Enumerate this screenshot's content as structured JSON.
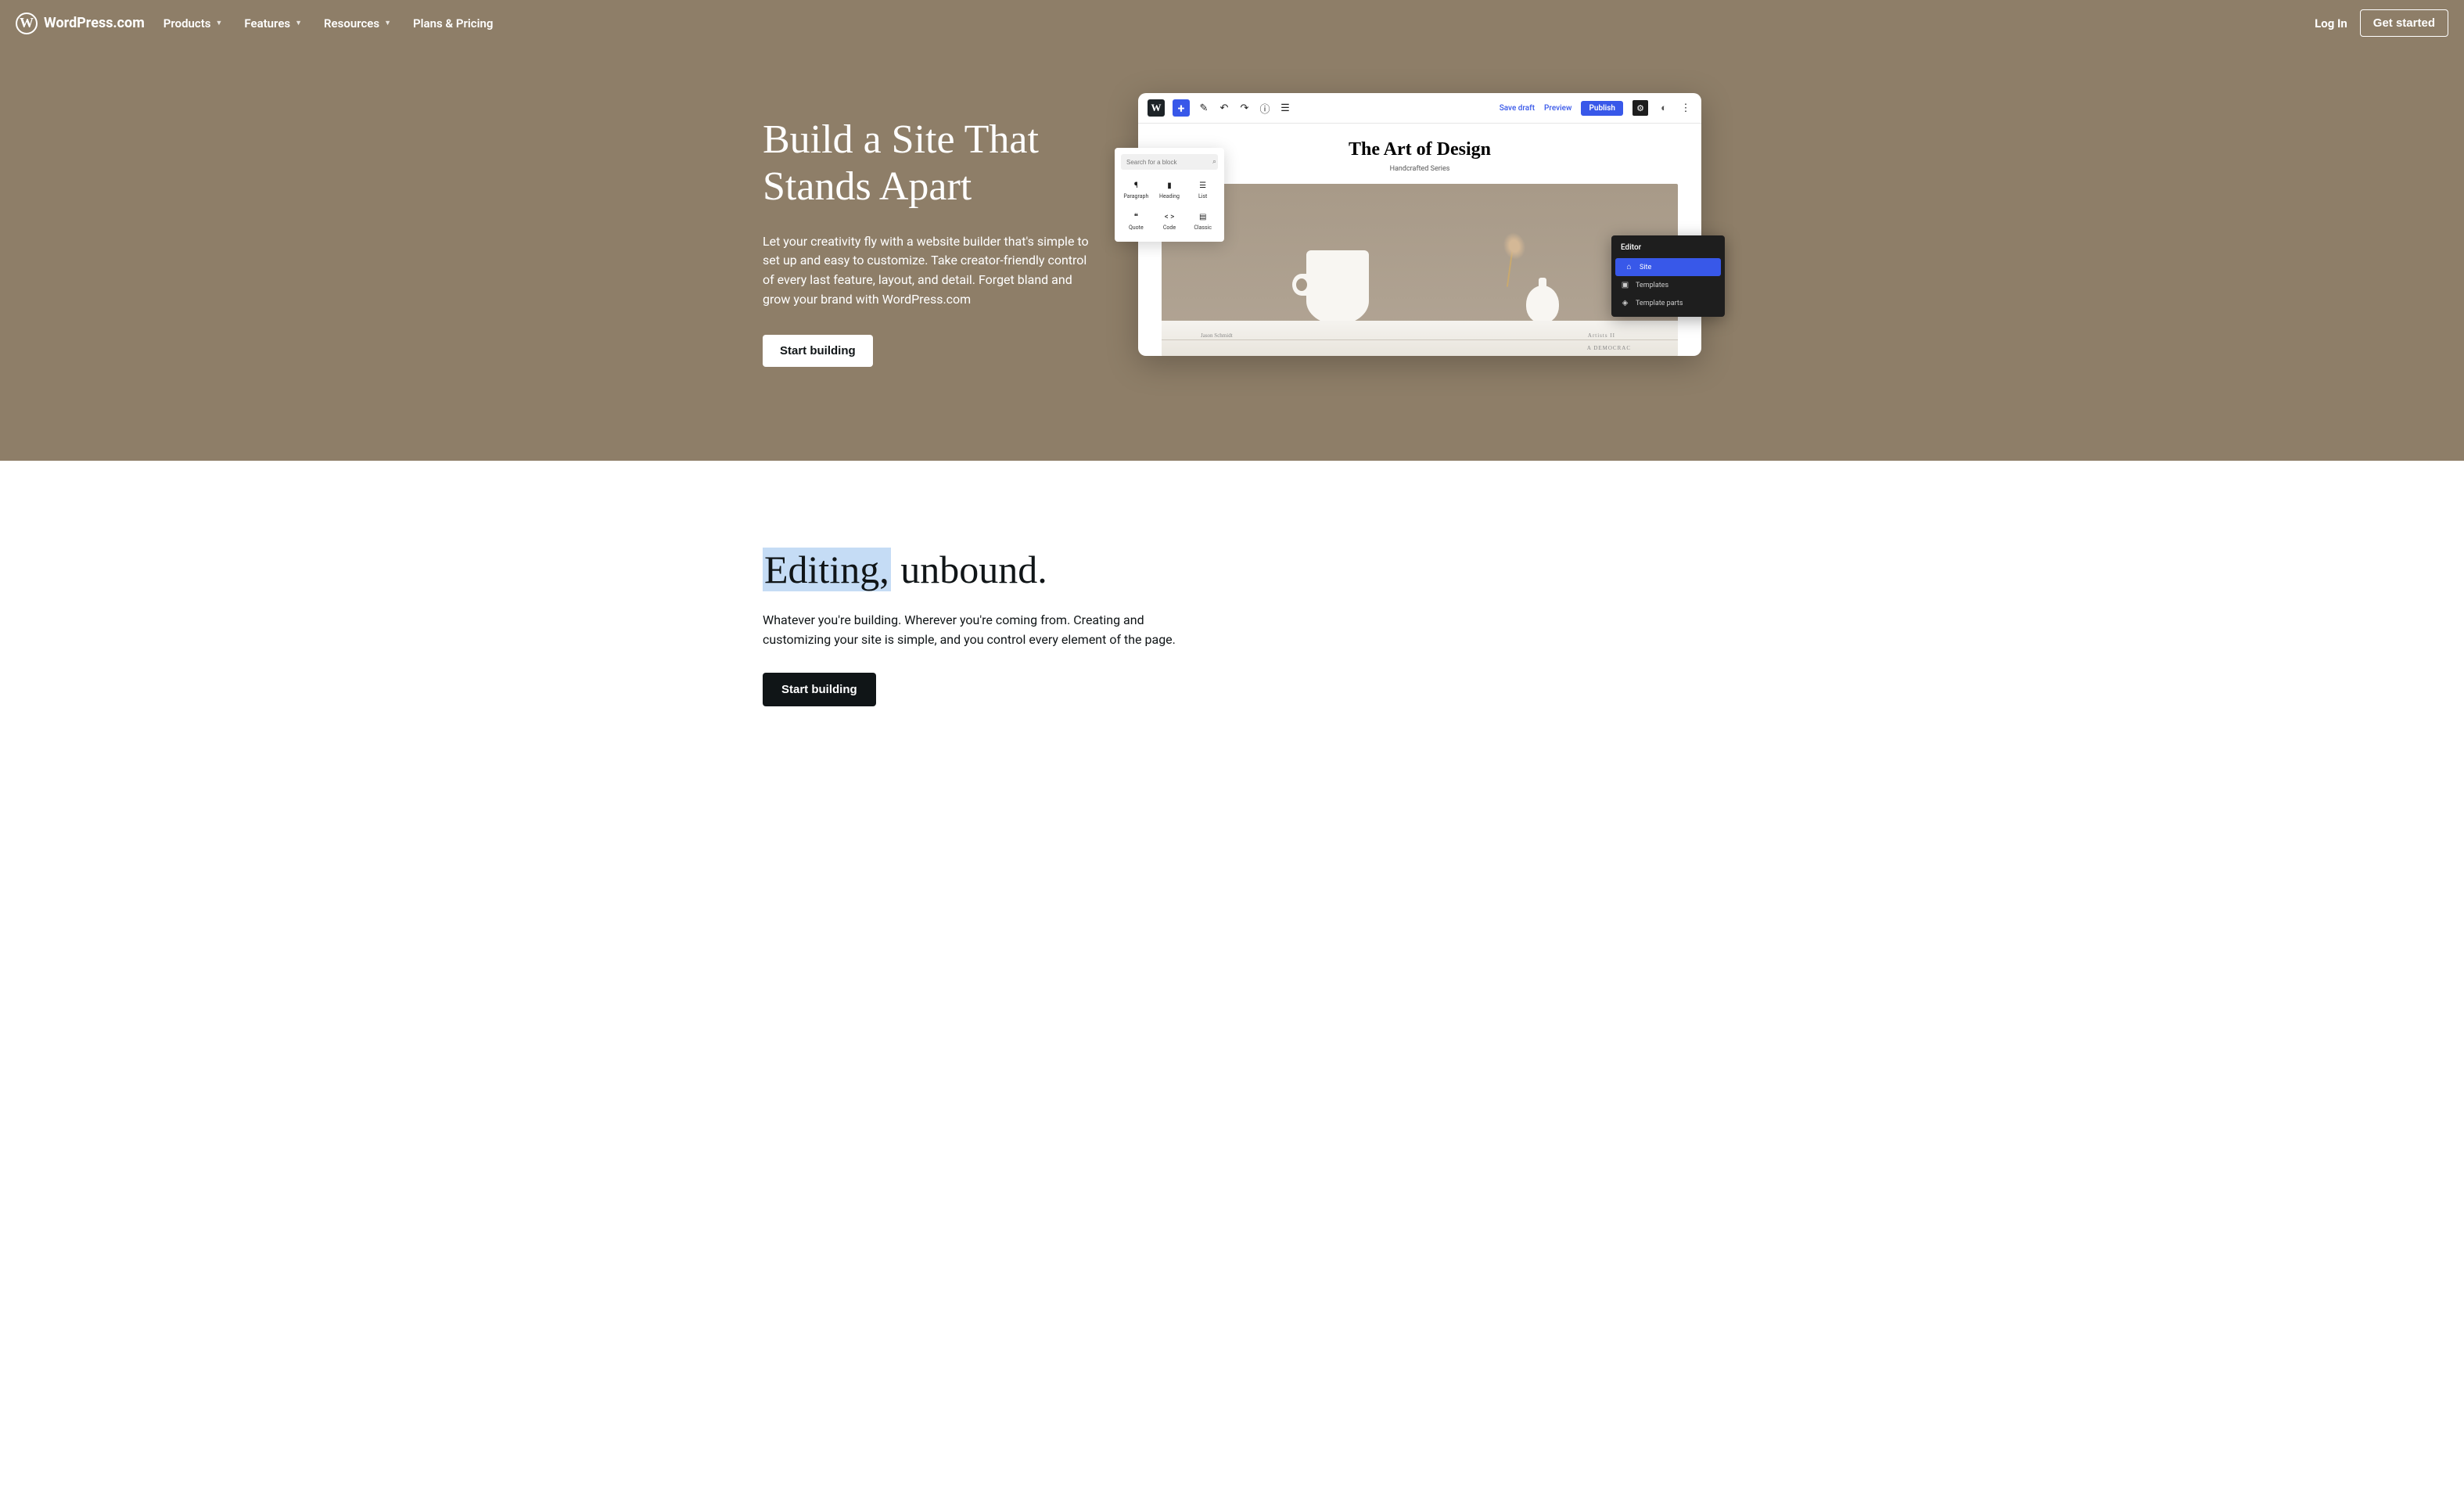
{
  "header": {
    "logo_text": "WordPress.com",
    "nav": [
      {
        "label": "Products",
        "has_dropdown": true
      },
      {
        "label": "Features",
        "has_dropdown": true
      },
      {
        "label": "Resources",
        "has_dropdown": true
      },
      {
        "label": "Plans & Pricing",
        "has_dropdown": false
      }
    ],
    "login": "Log In",
    "get_started": "Get started"
  },
  "hero": {
    "title": "Build a Site That Stands Apart",
    "description": "Let your creativity fly with a website builder that's simple to set up and easy to customize. Take creator-friendly control of every last feature, layout, and detail. Forget bland and grow your brand with WordPress.com",
    "cta": "Start building"
  },
  "editor": {
    "toolbar": {
      "save_draft": "Save draft",
      "preview": "Preview",
      "publish": "Publish"
    },
    "content_title": "The Art of Design",
    "content_subtitle": "Handcrafted Series",
    "book_spine_1": "A DEMOCRAC",
    "book_spine_2": "Artists II",
    "book_spine_3": "Jason Schmidt"
  },
  "block_popup": {
    "search_placeholder": "Search for a block",
    "blocks": [
      {
        "label": "Paragraph",
        "icon": "¶"
      },
      {
        "label": "Heading",
        "icon": "▮"
      },
      {
        "label": "List",
        "icon": "☰"
      },
      {
        "label": "Quote",
        "icon": "❝"
      },
      {
        "label": "Code",
        "icon": "< >"
      },
      {
        "label": "Classic",
        "icon": "▤"
      }
    ]
  },
  "sidebar_popup": {
    "title": "Editor",
    "items": [
      {
        "label": "Site",
        "icon": "⌂",
        "active": true
      },
      {
        "label": "Templates",
        "icon": "▣",
        "active": false
      },
      {
        "label": "Template parts",
        "icon": "◈",
        "active": false
      }
    ]
  },
  "section2": {
    "title_highlight": "Editing,",
    "title_rest": " unbound.",
    "description": "Whatever you're building. Wherever you're coming from. Creating and customizing your site is simple, and you control every element of the page.",
    "cta": "Start building"
  }
}
